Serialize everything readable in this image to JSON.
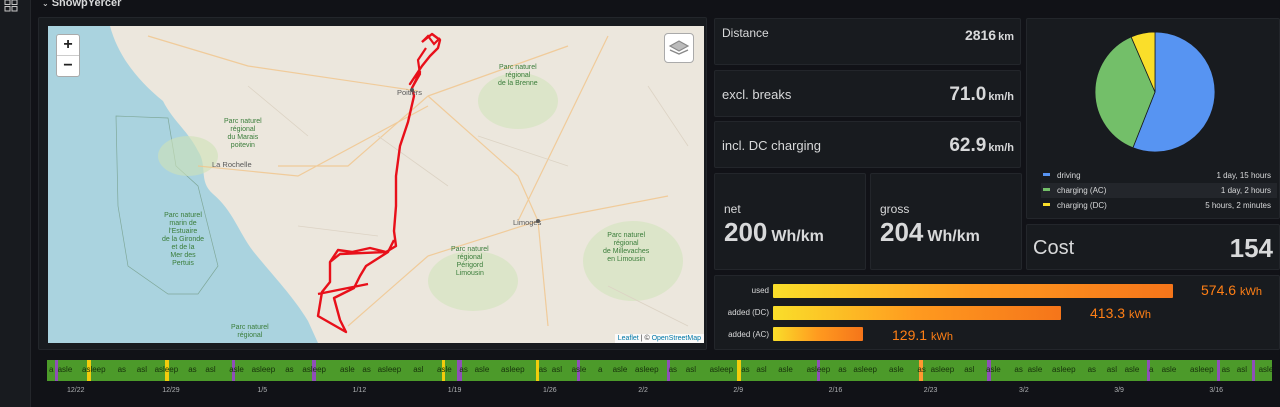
{
  "row_title": "SnowpYercer",
  "map": {
    "zoom_in": "+",
    "zoom_out": "−",
    "attribution_leaflet": "Leaflet",
    "attribution_sep": " | © ",
    "attribution_osm": "OpenStreetMap",
    "places": {
      "poitiers": "Poitiers",
      "la_rochelle": "La Rochelle",
      "limoges": "Limoges",
      "park_brenne": "Parc naturel\nrégional\nde la Brenne",
      "park_marais": "Parc naturel\nrégional\ndu Marais\npoitevin",
      "park_gironde": "Parc naturel\nmarin de\nl'Estuaire\nde la Gironde\net de la\nMer des\nPertuis",
      "park_perigord": "Parc naturel\nrégional\nPérigord\nLimousin",
      "park_millevaches": "Parc naturel\nrégional\nde Millevaches\nen Limousin",
      "park_bottom": "Parc naturel\nrégional"
    }
  },
  "stats": {
    "distance": {
      "label": "Distance",
      "value": "2816",
      "unit": "km"
    },
    "excl_breaks": {
      "label": "excl. breaks",
      "value": "71.0",
      "unit": "km/h"
    },
    "incl_dc": {
      "label": "incl. DC charging",
      "value": "62.9",
      "unit": "km/h"
    },
    "net": {
      "label": "net",
      "value": "200",
      "unit": "Wh/km"
    },
    "gross": {
      "label": "gross",
      "value": "204",
      "unit": "Wh/km"
    },
    "cost": {
      "label": "Cost",
      "value": "154"
    }
  },
  "pie": {
    "slices": [
      {
        "name": "driving",
        "value": "1 day, 15 hours",
        "color": "#5794f2",
        "fraction": 0.56
      },
      {
        "name": "charging (AC)",
        "value": "1 day, 2 hours",
        "color": "#73bf69",
        "fraction": 0.375
      },
      {
        "name": "charging (DC)",
        "value": "5 hours, 2 minutes",
        "color": "#fade2a",
        "fraction": 0.065
      }
    ]
  },
  "energy": {
    "used": {
      "label": "used",
      "value": "574.6",
      "unit": "kWh",
      "fraction": 1.0
    },
    "added_dc": {
      "label": "added (DC)",
      "value": "413.3",
      "unit": "kWh",
      "fraction": 0.72
    },
    "added_ac": {
      "label": "added (AC)",
      "value": "129.1",
      "unit": "kWh",
      "fraction": 0.225
    }
  },
  "timeline": {
    "words": [
      "a",
      "asle",
      "asleep",
      "as",
      "asl",
      "asleep",
      "as",
      "asl",
      "asle",
      "asleep",
      "as",
      "asleep",
      "asle",
      "as",
      "asleep",
      "asl",
      "asle",
      "as",
      "asle",
      "asleep",
      "as",
      "asl",
      "asle"
    ],
    "ticks": [
      "12/22",
      "12/29",
      "1/5",
      "1/12",
      "1/19",
      "1/26",
      "2/2",
      "2/9",
      "2/16",
      "2/23",
      "3/2",
      "3/9",
      "3/16"
    ]
  }
}
